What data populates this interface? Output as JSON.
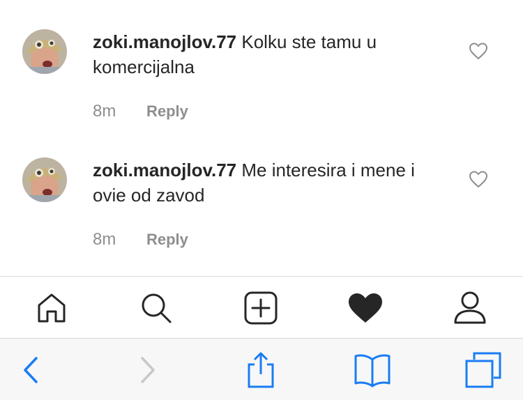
{
  "comments": [
    {
      "username": "zoki.manojlov.77",
      "text": "Kolku ste tamu u komercijalna",
      "time": "8m",
      "reply_label": "Reply"
    },
    {
      "username": "zoki.manojlov.77",
      "text": "Me interesira i mene i ovie od zavod",
      "time": "8m",
      "reply_label": "Reply"
    }
  ],
  "tab_bar": {
    "items": [
      "home-icon",
      "search-icon",
      "new-post-icon",
      "activity-heart-icon",
      "profile-icon"
    ],
    "active": "activity-heart-icon"
  },
  "browser_toolbar": {
    "items": [
      "back-icon",
      "forward-icon",
      "share-icon",
      "bookmarks-icon",
      "tabs-icon"
    ],
    "accent_color": "#1a7cf4",
    "disabled_color": "#c7c7cc"
  },
  "colors": {
    "text": "#262626",
    "secondary": "#8e8e8e"
  }
}
